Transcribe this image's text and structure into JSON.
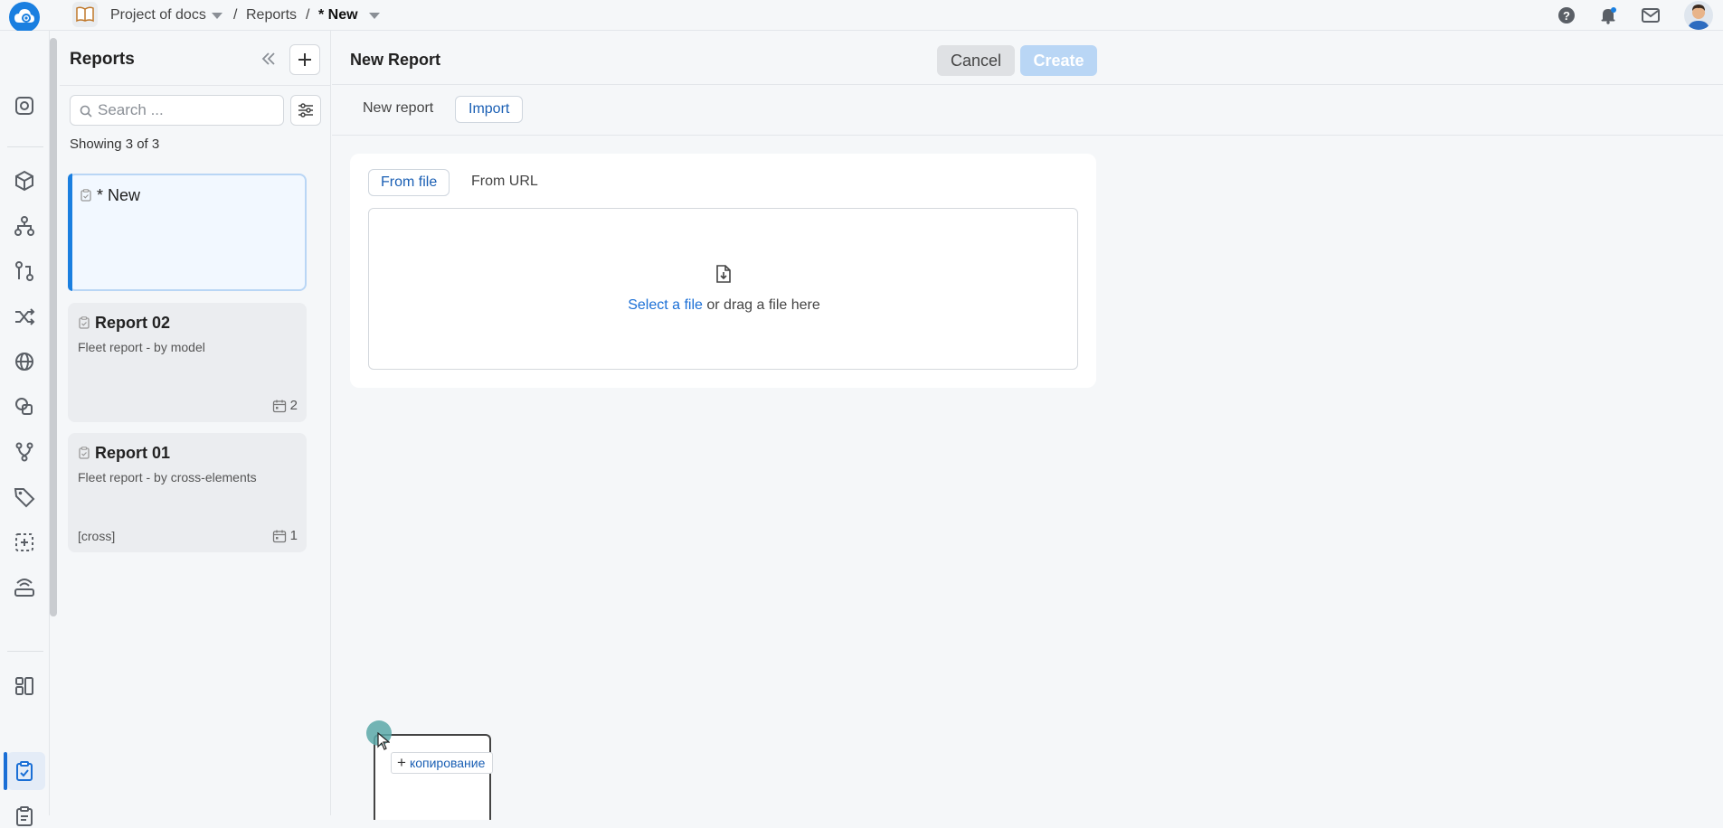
{
  "topbar": {
    "project": "Project of docs",
    "section": "Reports",
    "separator": "/",
    "current": "* New"
  },
  "sidebar": {
    "title": "Reports",
    "search_placeholder": "Search ...",
    "showing": "Showing 3 of 3",
    "cards": [
      {
        "title": "* New",
        "subtitle": "",
        "tag": "",
        "count": ""
      },
      {
        "title": "Report 02",
        "subtitle": "Fleet report - by model",
        "tag": "",
        "count": "2"
      },
      {
        "title": "Report 01",
        "subtitle": "Fleet report - by cross-elements",
        "tag": "[cross]",
        "count": "1"
      }
    ]
  },
  "main": {
    "title": "New Report",
    "cancel_label": "Cancel",
    "create_label": "Create",
    "tabs": [
      {
        "label": "New report"
      },
      {
        "label": "Import"
      }
    ],
    "subtabs": [
      {
        "label": "From file"
      },
      {
        "label": "From URL"
      }
    ],
    "dropzone": {
      "link": "Select a file",
      "text": " or drag a file here"
    }
  },
  "drag": {
    "label": "копирование"
  },
  "colors": {
    "accent": "#1a7fe0",
    "create_disabled": "#b9d6f5",
    "link": "#1a6fd6"
  }
}
